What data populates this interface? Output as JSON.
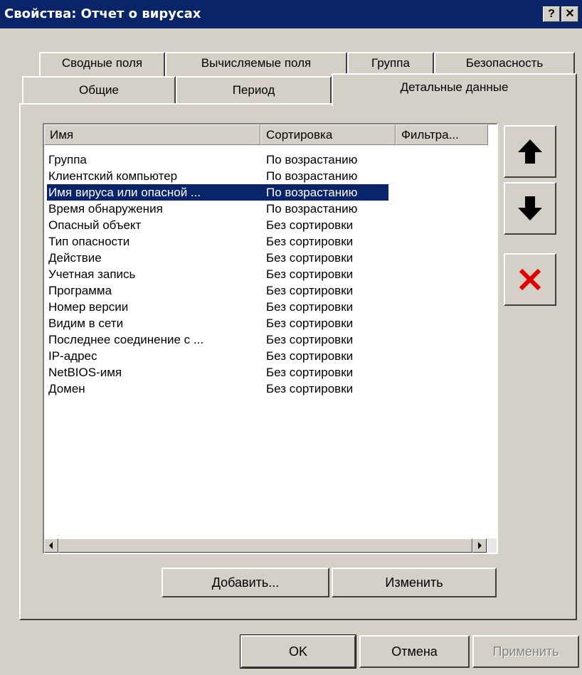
{
  "window": {
    "title": "Свойства: Отчет о вирусах",
    "help_label": "?",
    "close_label": "✕"
  },
  "tabs_back": [
    "Сводные поля",
    "Вычисляемые поля",
    "Группа",
    "Безопасность"
  ],
  "tabs_front": [
    "Общие",
    "Период",
    "Детальные данные"
  ],
  "list": {
    "columns": [
      "Имя",
      "Сортировка",
      "Фильтра..."
    ],
    "rows": [
      {
        "name": "Группа",
        "sort": "По возрастанию"
      },
      {
        "name": "Клиентский компьютер",
        "sort": "По возрастанию"
      },
      {
        "name": "Имя вируса или опасной ...",
        "sort": "По возрастанию"
      },
      {
        "name": "Время обнаружения",
        "sort": "По возрастанию"
      },
      {
        "name": "Опасный объект",
        "sort": "Без сортировки"
      },
      {
        "name": "Тип опасности",
        "sort": "Без сортировки"
      },
      {
        "name": "Действие",
        "sort": "Без сортировки"
      },
      {
        "name": "Учетная запись",
        "sort": "Без сортировки"
      },
      {
        "name": "Программа",
        "sort": "Без сортировки"
      },
      {
        "name": "Номер версии",
        "sort": "Без сортировки"
      },
      {
        "name": "Видим в сети",
        "sort": "Без сортировки"
      },
      {
        "name": "Последнее соединение с ...",
        "sort": "Без сортировки"
      },
      {
        "name": "IP-адрес",
        "sort": "Без сортировки"
      },
      {
        "name": "NetBIOS-имя",
        "sort": "Без сортировки"
      },
      {
        "name": "Домен",
        "sort": "Без сортировки"
      }
    ]
  },
  "buttons": {
    "add": "Добавить...",
    "edit": "Изменить",
    "ok": "OK",
    "cancel": "Отмена",
    "apply": "Применить"
  },
  "icons": {
    "up": "arrow-up-icon",
    "down": "arrow-down-icon",
    "delete": "delete-x-icon"
  },
  "colors": {
    "titlebar": "#0a246a",
    "selection": "#0a246a",
    "delete_red": "#e00000"
  }
}
